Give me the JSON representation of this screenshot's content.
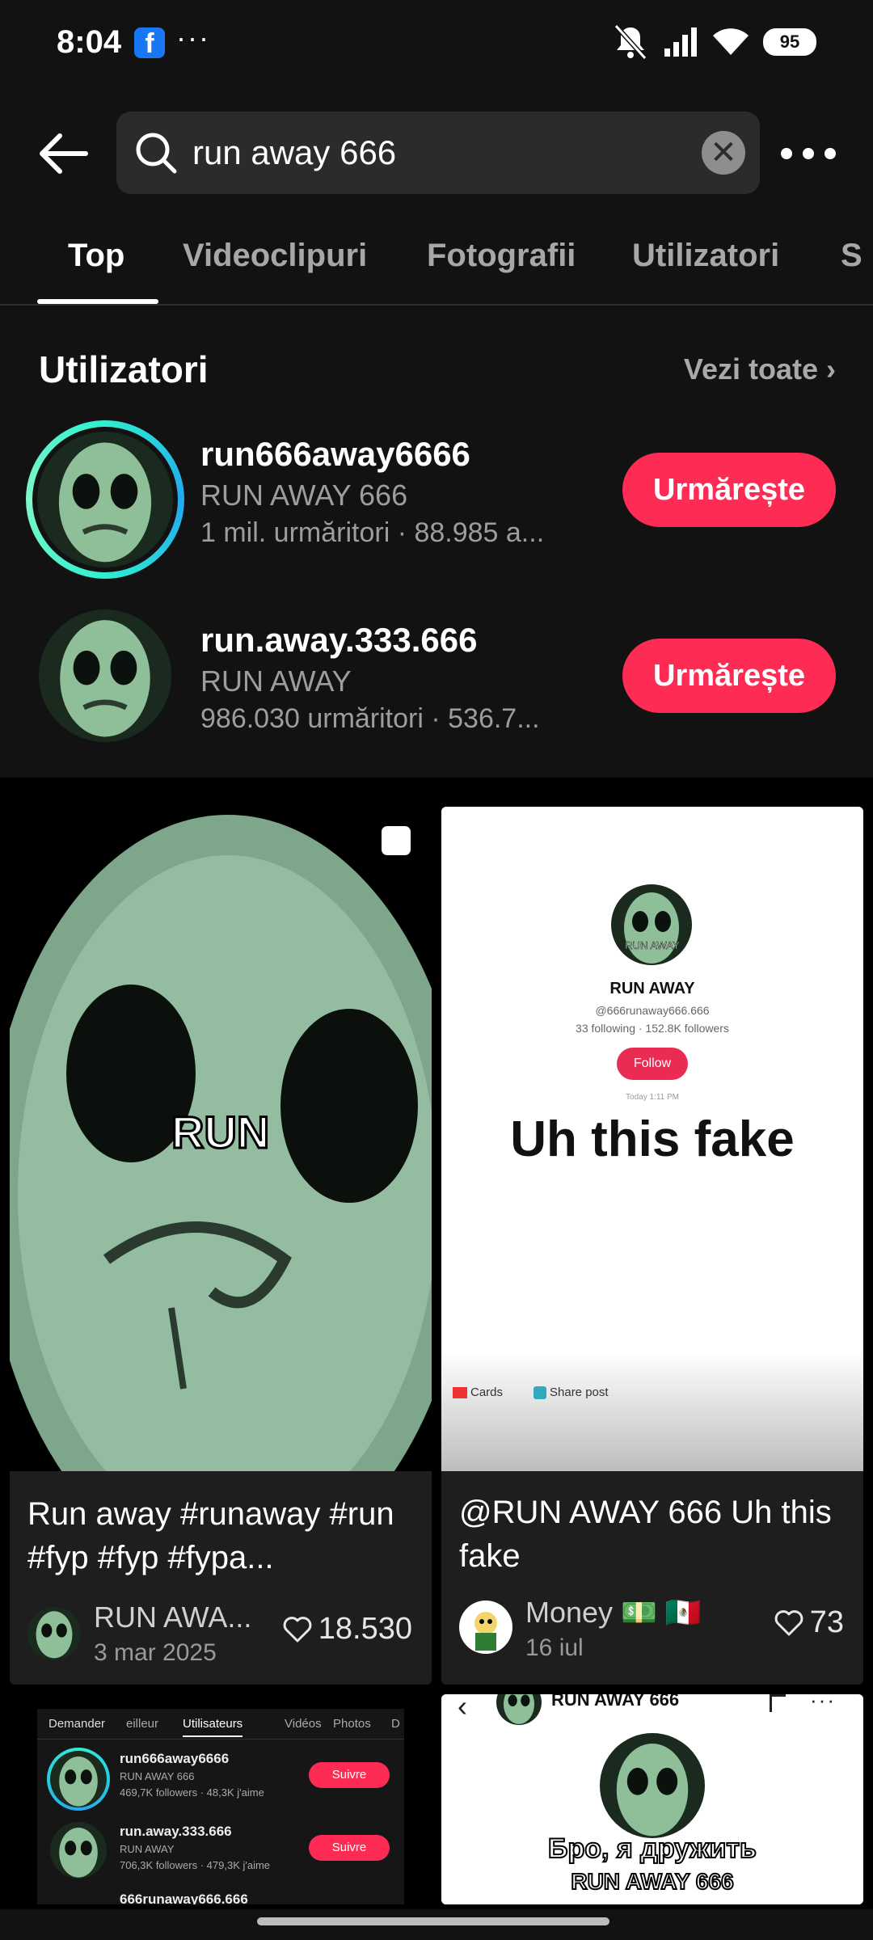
{
  "status": {
    "time": "8:04",
    "battery": "95",
    "fb_label": "f",
    "dots": "···"
  },
  "search": {
    "query": "run away 666",
    "clear_symbol": "✕"
  },
  "tabs": [
    {
      "label": "Top"
    },
    {
      "label": "Videoclipuri"
    },
    {
      "label": "Fotografii"
    },
    {
      "label": "Utilizatori"
    },
    {
      "label": "S"
    }
  ],
  "users": {
    "title": "Utilizatori",
    "see_all": "Vezi toate",
    "items": [
      {
        "name": "run666away6666",
        "display": "RUN AWAY 666",
        "stats": "1 mil. urmăritori · 88.985 a...",
        "follow": "Urmărește"
      },
      {
        "name": "run.away.333.666",
        "display": "RUN AWAY",
        "stats": "986.030 urmăritori · 536.7...",
        "follow": "Urmărește"
      }
    ]
  },
  "videos": [
    {
      "overlay": "RUN",
      "caption": "Run away #runaway #run #fyp #fyp #fypa...",
      "author": "RUN AWA...",
      "date": "3 mar 2025",
      "likes": "18.530"
    },
    {
      "profile_name": "RUN AWAY",
      "profile_handle": "@666runaway666.666",
      "profile_stats": "33 following · 152.8K followers",
      "follow": "Follow",
      "ts": "Today 1:11 PM",
      "overlay": "Uh this fake",
      "chip1": "Cards",
      "chip2": "Share post",
      "avatar_text": "RUN AWAY",
      "caption": "@RUN AWAY 666 Uh this fake",
      "author": "Money 💵 🇲🇽",
      "date": "16 iul",
      "likes": "73"
    },
    {
      "tabs": [
        "Demander",
        "eilleur",
        "Utilisateurs",
        "Vidéos",
        "Photos",
        "D"
      ],
      "rows": [
        {
          "name": "run666away6666",
          "sub": "RUN AWAY 666",
          "stats": "469,7K followers · 48,3K j'aime",
          "btn": "Suivre"
        },
        {
          "name": "run.away.333.666",
          "sub": "RUN AWAY",
          "stats": "706,3K followers · 479,3K j'aime",
          "btn": "Suivre"
        }
      ],
      "row3": "666runaway666.666"
    },
    {
      "header": "RUN AWAY 666",
      "overlay1": "Бро, я дружить",
      "overlay2": "RUN AWAY 666"
    }
  ],
  "icons": {
    "back": "arrow-left-icon",
    "search": "search-icon",
    "more": "more-horizontal-icon",
    "heart": "heart-icon",
    "multi": "carousel-icon"
  }
}
